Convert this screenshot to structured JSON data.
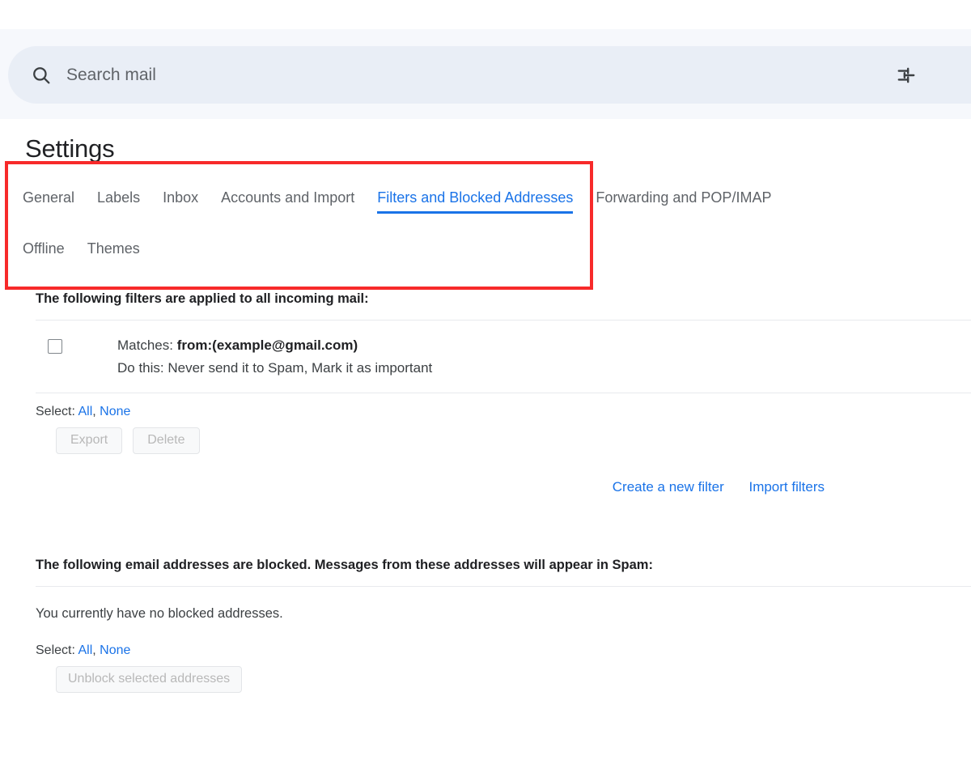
{
  "search": {
    "placeholder": "Search mail",
    "value": "",
    "icon": "search-icon",
    "filter_icon": "tune-icon"
  },
  "header": {
    "title": "Settings"
  },
  "tabs": {
    "row_one": [
      {
        "label": "General",
        "active": false
      },
      {
        "label": "Labels",
        "active": false
      },
      {
        "label": "Inbox",
        "active": false
      },
      {
        "label": "Accounts and Import",
        "active": false
      },
      {
        "label": "Filters and Blocked Addresses",
        "active": true
      },
      {
        "label": "Forwarding and POP/IMAP",
        "active": false
      }
    ],
    "row_two": [
      {
        "label": "Offline",
        "active": false
      },
      {
        "label": "Themes",
        "active": false
      }
    ]
  },
  "filters_section": {
    "heading": "The following filters are applied to all incoming mail:",
    "rows": [
      {
        "matches_label": "Matches:",
        "matches_value": "from:(example@gmail.com)",
        "action_label": "Do this:",
        "action_value": "Never send it to Spam, Mark it as important",
        "checked": false
      }
    ],
    "select_label": "Select:",
    "select_all": "All",
    "select_separator": ",",
    "select_none": "None",
    "buttons": [
      {
        "label": "Export",
        "disabled": true
      },
      {
        "label": "Delete",
        "disabled": true
      }
    ],
    "actions": [
      {
        "label": "Create a new filter"
      },
      {
        "label": "Import filters"
      }
    ]
  },
  "blocked_section": {
    "heading": "The following email addresses are blocked. Messages from these addresses will appear in Spam:",
    "empty_message": "You currently have no blocked addresses.",
    "select_label": "Select:",
    "select_all": "All",
    "select_separator": ",",
    "select_none": "None",
    "unblock_button": "Unblock selected addresses"
  },
  "colors": {
    "accent_blue": "#1a73e8",
    "highlight_red": "#f72a2a",
    "search_bg": "#e9eef6",
    "band_bg": "#f6f8fc"
  }
}
